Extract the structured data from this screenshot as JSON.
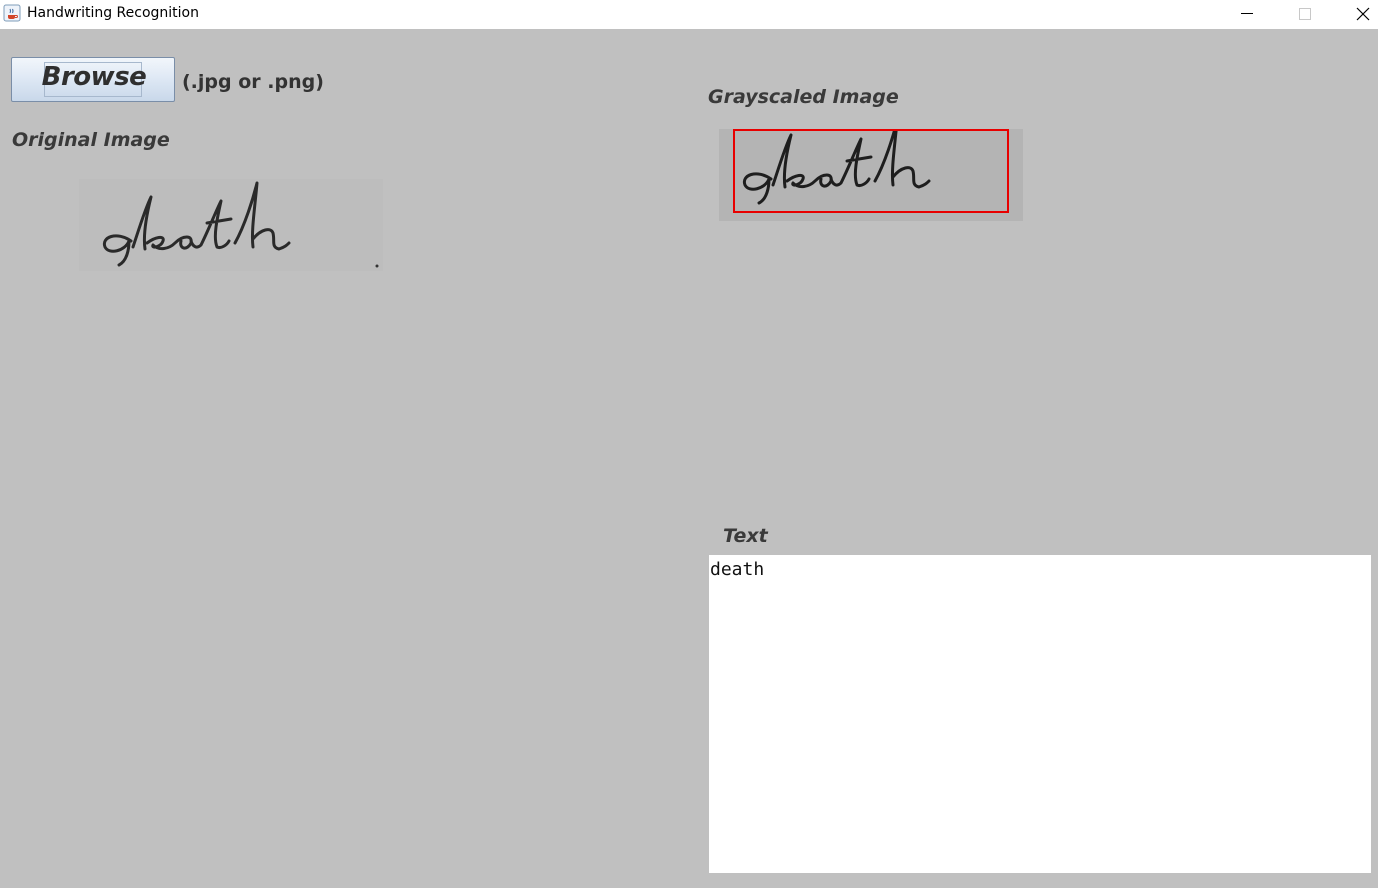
{
  "window": {
    "title": "Handwriting Recognition",
    "icon": "java-coffee-icon",
    "controls": [
      "minimize-icon",
      "maximize-icon",
      "close-icon"
    ]
  },
  "toolbar": {
    "browse_label": "Browse",
    "file_hint": "(.jpg or .png)"
  },
  "panels": {
    "original_label": "Original Image",
    "grayscale_label": "Grayscaled Image",
    "text_label": "Text"
  },
  "images": {
    "original_handwriting": "death",
    "grayscale_handwriting": "death",
    "bounding_box_color": "#e80000"
  },
  "output": {
    "recognized_text": "death"
  },
  "colors": {
    "background": "#c0c0c0",
    "titlebar": "#ffffff",
    "text_area": "#ffffff"
  }
}
